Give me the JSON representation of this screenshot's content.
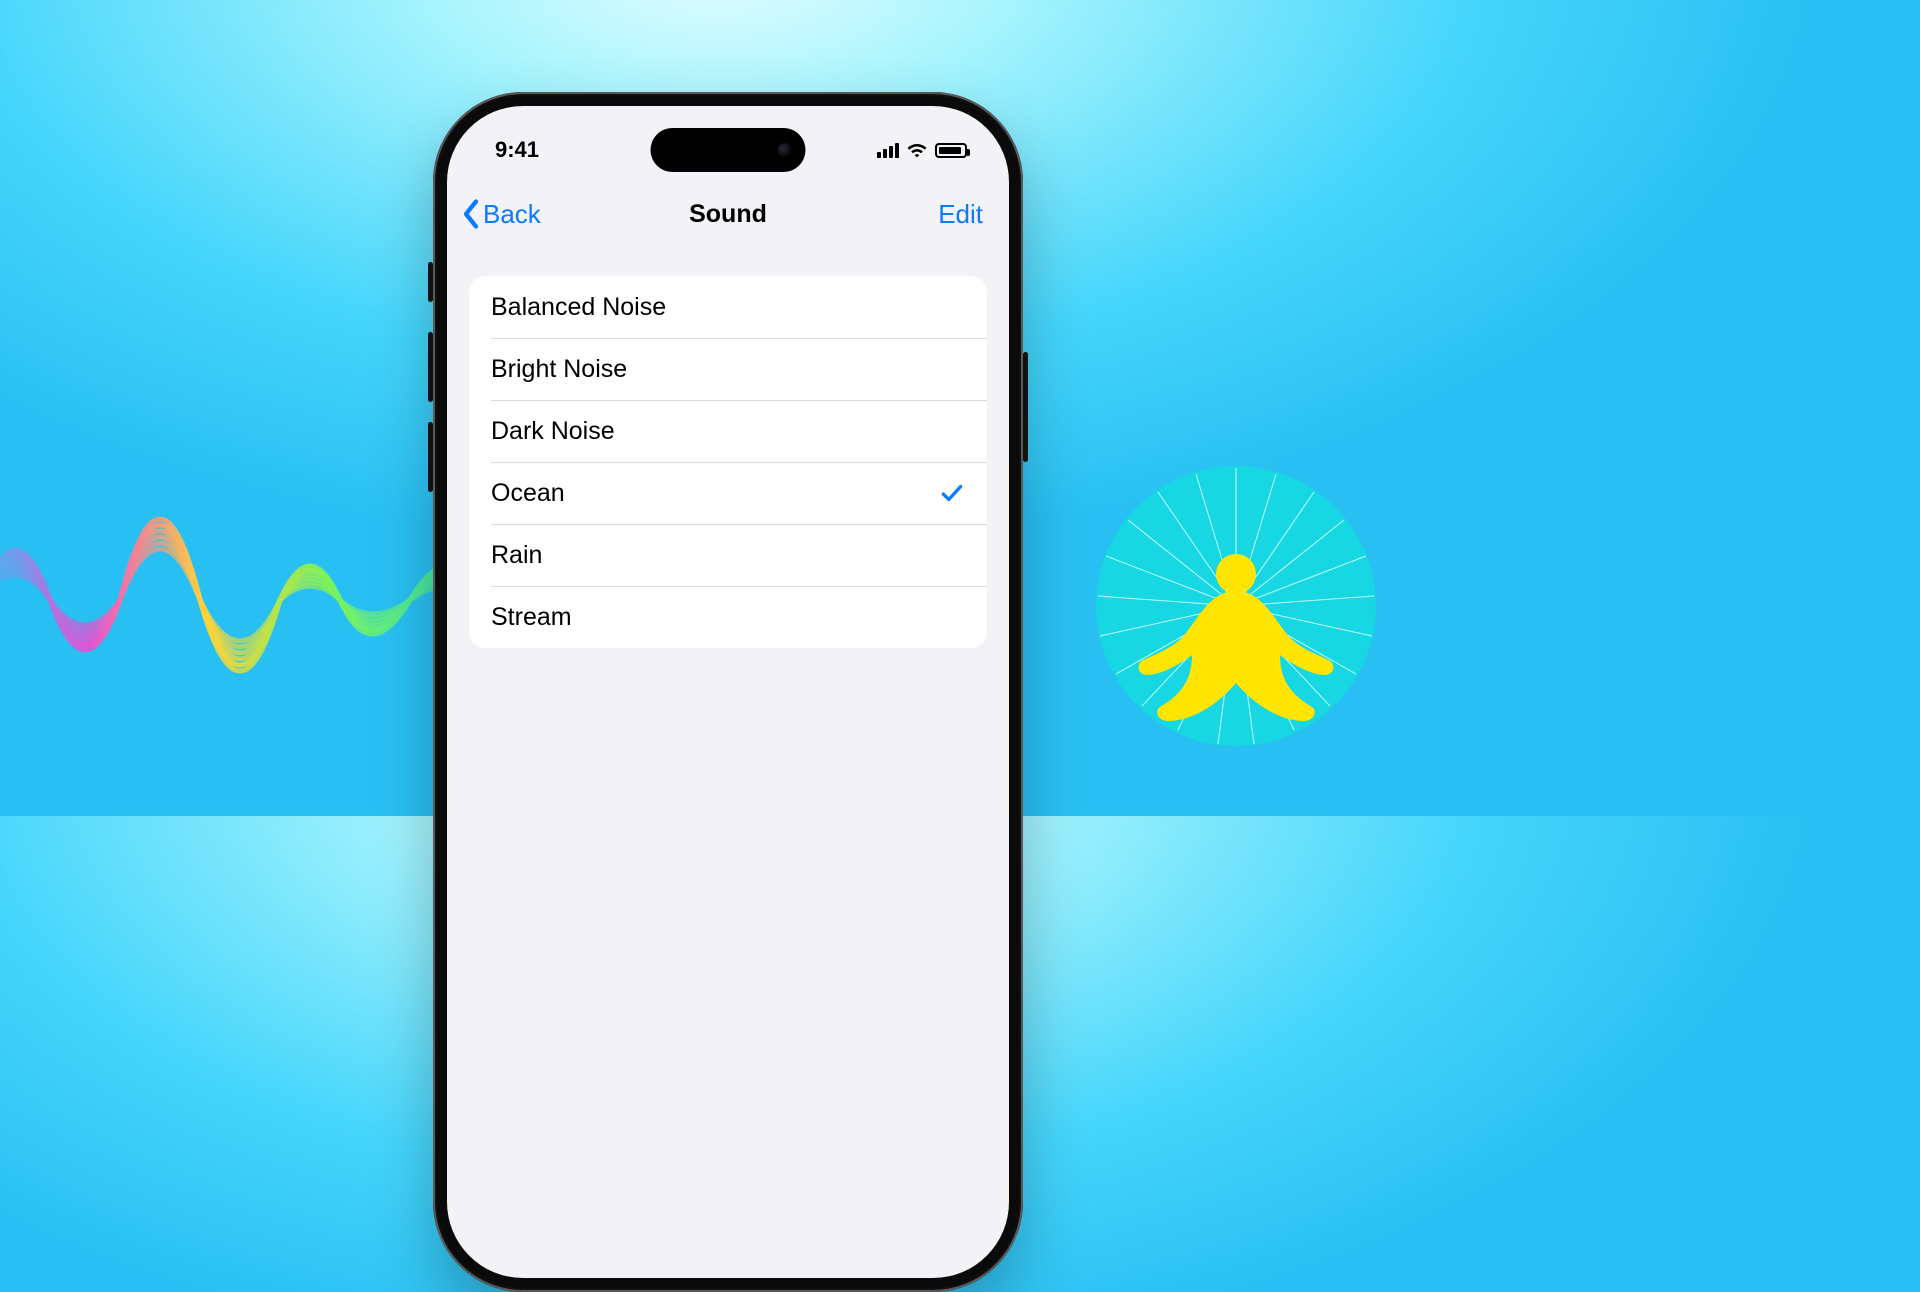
{
  "statusBar": {
    "time": "9:41"
  },
  "nav": {
    "back": "Back",
    "title": "Sound",
    "edit": "Edit"
  },
  "sounds": [
    {
      "label": "Balanced Noise",
      "selected": false
    },
    {
      "label": "Bright Noise",
      "selected": false
    },
    {
      "label": "Dark Noise",
      "selected": false
    },
    {
      "label": "Ocean",
      "selected": true
    },
    {
      "label": "Rain",
      "selected": false
    },
    {
      "label": "Stream",
      "selected": false
    }
  ],
  "colors": {
    "accent": "#0a7aff"
  }
}
